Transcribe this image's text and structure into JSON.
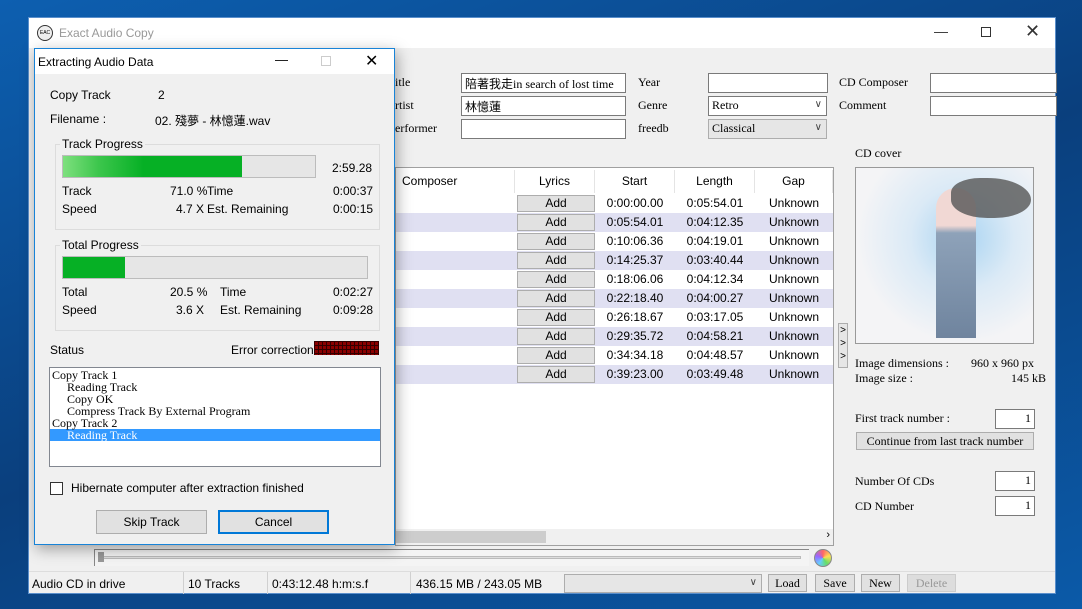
{
  "main": {
    "title": "Exact Audio Copy",
    "icon": "eac-logo",
    "fields": {
      "title_label": "itle",
      "title_value": "陪著我走in search of lost time",
      "artist_label": "rtist",
      "artist_value": "林憶蓮",
      "performer_label": "erformer",
      "performer_value": "",
      "year_label": "Year",
      "year_value": "",
      "genre_label": "Genre",
      "genre_value": "Retro",
      "freedb_label": "freedb",
      "freedb_value": "Classical",
      "cd_composer_label": "CD Composer",
      "cd_composer_value": "",
      "comment_label": "Comment",
      "comment_value": ""
    },
    "table": {
      "columns": [
        "Composer",
        "Lyrics",
        "Start",
        "Length",
        "Gap"
      ],
      "rows": [
        {
          "lyrics": "Add",
          "start": "0:00:00.00",
          "length": "0:05:54.01",
          "gap": "Unknown"
        },
        {
          "lyrics": "Add",
          "start": "0:05:54.01",
          "length": "0:04:12.35",
          "gap": "Unknown"
        },
        {
          "lyrics": "Add",
          "start": "0:10:06.36",
          "length": "0:04:19.01",
          "gap": "Unknown"
        },
        {
          "lyrics": "Add",
          "start": "0:14:25.37",
          "length": "0:03:40.44",
          "gap": "Unknown"
        },
        {
          "lyrics": "Add",
          "start": "0:18:06.06",
          "length": "0:04:12.34",
          "gap": "Unknown"
        },
        {
          "lyrics": "Add",
          "start": "0:22:18.40",
          "length": "0:04:00.27",
          "gap": "Unknown"
        },
        {
          "lyrics": "Add",
          "start": "0:26:18.67",
          "length": "0:03:17.05",
          "gap": "Unknown"
        },
        {
          "lyrics": "Add",
          "start": "0:29:35.72",
          "length": "0:04:58.21",
          "gap": "Unknown"
        },
        {
          "lyrics": "Add",
          "start": "0:34:34.18",
          "length": "0:04:48.57",
          "gap": "Unknown"
        },
        {
          "lyrics": "Add",
          "start": "0:39:23.00",
          "length": "0:03:49.48",
          "gap": "Unknown"
        }
      ]
    },
    "cover": {
      "label": "CD cover",
      "dimensions_label": "Image dimensions :",
      "dimensions_value": "960 x 960 px",
      "size_label": "Image size :",
      "size_value": "145 kB"
    },
    "first_track_label": "First track number :",
    "first_track_value": "1",
    "continue_button": "Continue from last track number",
    "num_cds_label": "Number Of CDs",
    "num_cds_value": "1",
    "cd_number_label": "CD Number",
    "cd_number_value": "1",
    "status_bar": {
      "drive": "Audio CD in drive",
      "tracks": "10 Tracks",
      "duration": "0:43:12.48 h:m:s.f",
      "size": "436.15 MB / 243.05 MB"
    },
    "buttons": {
      "load": "Load",
      "save": "Save",
      "new": "New",
      "delete": "Delete"
    }
  },
  "dialog": {
    "title": "Extracting Audio Data",
    "copy_track_label": "Copy Track",
    "copy_track_value": "2",
    "filename_label": "Filename :",
    "filename_value": "02. 殘夢 - 林憶蓮.wav",
    "track_progress": {
      "label": "Track Progress",
      "percent": 71.0,
      "bar_time": "2:59.28",
      "track_label": "Track",
      "track_value": "71.0 %",
      "time_label": "Time",
      "time_value": "0:00:37",
      "speed_label": "Speed",
      "speed_value": "4.7 X",
      "remaining_label": "Est. Remaining",
      "remaining_value": "0:00:15"
    },
    "total_progress": {
      "label": "Total Progress",
      "percent": 20.5,
      "total_label": "Total",
      "total_value": "20.5 %",
      "time_label": "Time",
      "time_value": "0:02:27",
      "speed_label": "Speed",
      "speed_value": "3.6 X",
      "remaining_label": "Est. Remaining",
      "remaining_value": "0:09:28"
    },
    "status_label": "Status",
    "error_correction_label": "Error correction :",
    "log": [
      "Copy Track  1",
      "Reading Track",
      "Copy OK",
      "Compress Track By External Program",
      "Copy Track  2",
      "Reading Track"
    ],
    "hibernate_label": "Hibernate computer after extraction finished",
    "hibernate_checked": false,
    "skip_button": "Skip Track",
    "cancel_button": "Cancel"
  },
  "colors": {
    "progress": "#06b025",
    "selection": "#3399ff",
    "accent": "#1883d7",
    "error_led": "#8b0000"
  }
}
